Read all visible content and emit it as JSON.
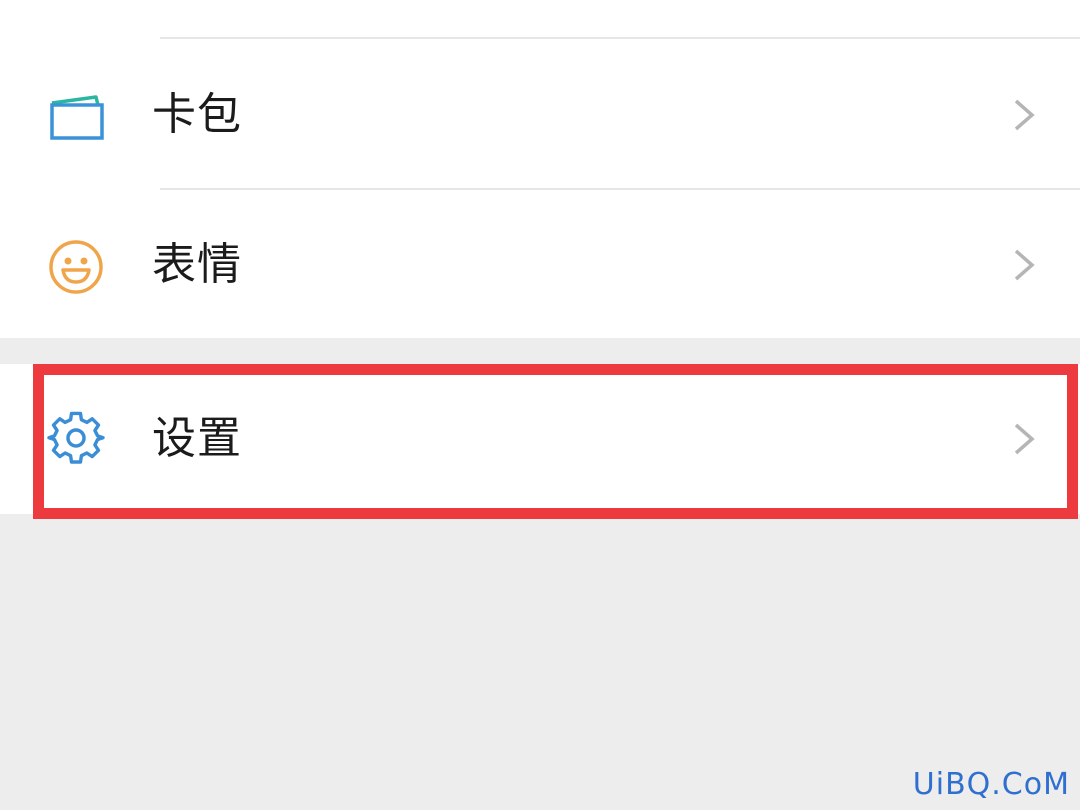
{
  "menu": {
    "items": [
      {
        "label": "卡包",
        "icon": "card-wallet-icon"
      },
      {
        "label": "表情",
        "icon": "smiley-icon"
      },
      {
        "label": "设置",
        "icon": "gear-icon"
      }
    ]
  },
  "watermark": {
    "text": "UiBQ.CoM"
  },
  "colors": {
    "background": "#ededed",
    "row_background": "#ffffff",
    "highlight": "#ec3a3f",
    "gear": "#3b8ed6",
    "smiley": "#f0a54a",
    "card_teal": "#2bb6a2",
    "card_blue": "#3a93d8",
    "chevron": "#b5b5b5",
    "watermark": "#2e6fd0"
  }
}
